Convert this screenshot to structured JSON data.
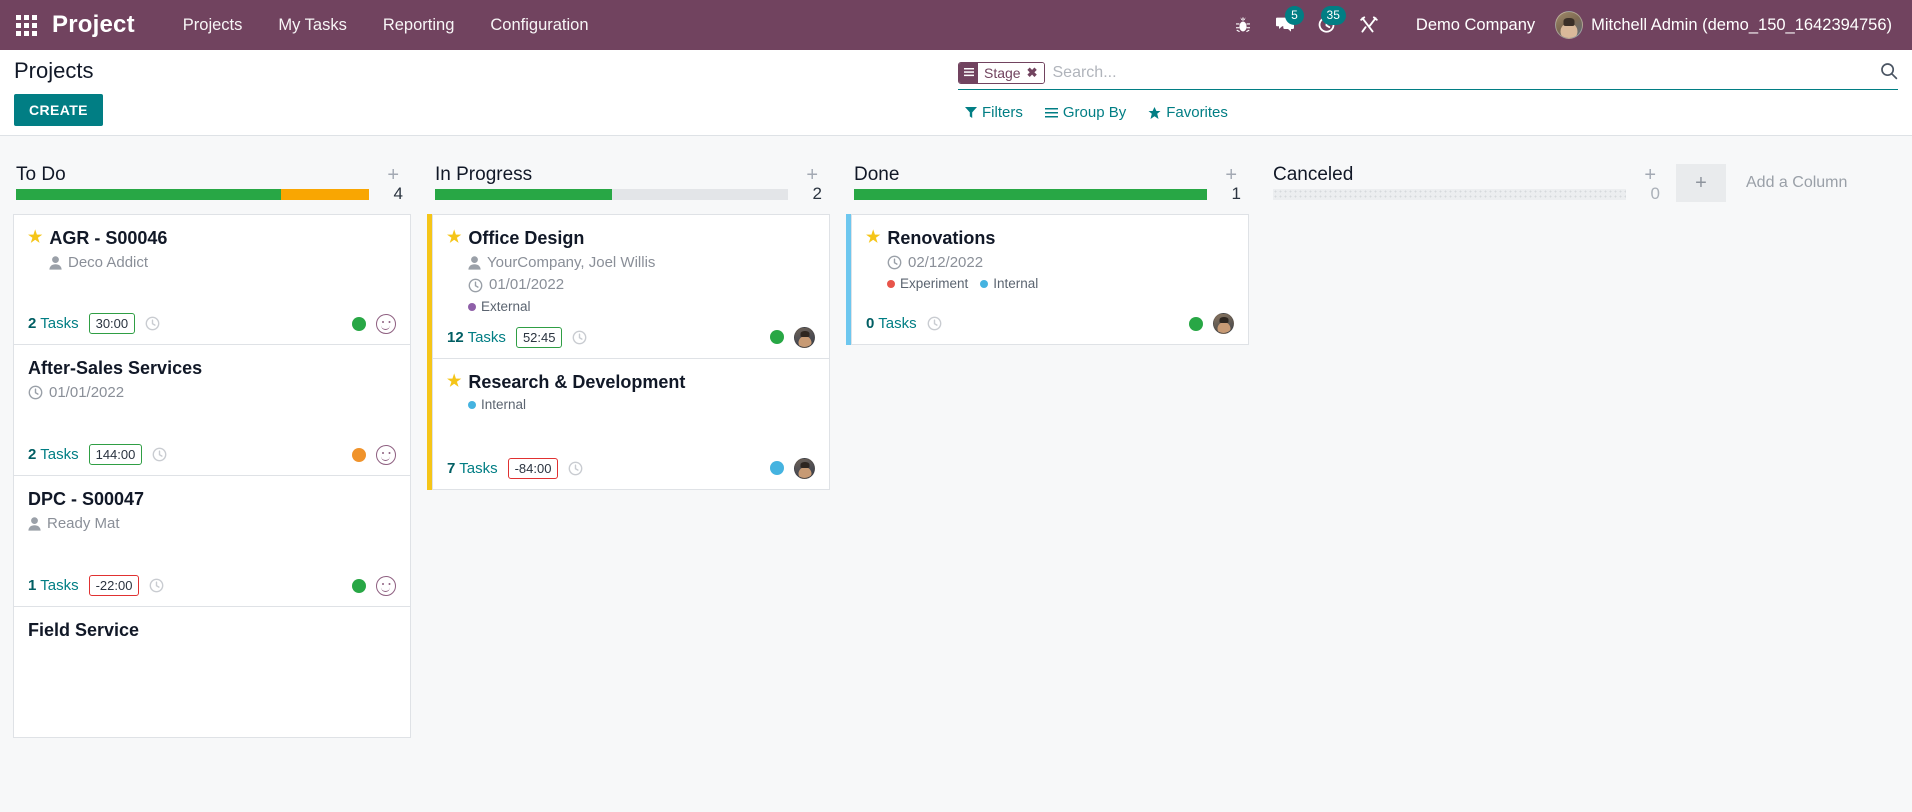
{
  "navbar": {
    "apps_icon": "apps-grid-icon",
    "brand": "Project",
    "menu": [
      {
        "label": "Projects"
      },
      {
        "label": "My Tasks"
      },
      {
        "label": "Reporting"
      },
      {
        "label": "Configuration"
      }
    ],
    "icons": [
      {
        "name": "bug-icon",
        "badge": null
      },
      {
        "name": "messages-icon",
        "badge": "5"
      },
      {
        "name": "activities-clock-icon",
        "badge": "35"
      },
      {
        "name": "tools-icon",
        "badge": null
      }
    ],
    "company": "Demo Company",
    "user": "Mitchell Admin (demo_150_1642394756)"
  },
  "control_panel": {
    "title": "Projects",
    "create_label": "CREATE",
    "facet": {
      "label": "Stage",
      "close": "✖"
    },
    "search_placeholder": "Search...",
    "filters": [
      {
        "label": "Filters",
        "icon": "filter-icon"
      },
      {
        "label": "Group By",
        "icon": "group-by-icon"
      },
      {
        "label": "Favorites",
        "icon": "star-icon"
      }
    ]
  },
  "colors": {
    "brand_purple": "#71435f",
    "accent_teal": "#017e84",
    "bar_green": "#28a745",
    "bar_orange": "#f9a602",
    "bar_grey": "#e3e5e8",
    "dot_green": "#28a745",
    "dot_orange": "#f0932b",
    "dot_blue": "#45b3e0",
    "star_yellow": "#f5c518",
    "tag_purple": "#8e5fa8",
    "tag_blue": "#45b3e0",
    "tag_red": "#e8544a",
    "group_yellow": "#f5c518",
    "group_lightblue": "#6dc7ef"
  },
  "kanban": {
    "add_column_label": "Add a Column",
    "columns": [
      {
        "title": "To Do",
        "count": "4",
        "progress": [
          {
            "color": "#28a745",
            "pct": 75
          },
          {
            "color": "#f9a602",
            "pct": 25
          }
        ],
        "group_border": "transparent",
        "cards": [
          {
            "title": "AGR - S00046",
            "starred": true,
            "partner": "Deco Addict",
            "date": null,
            "tags": [],
            "tasks": "2",
            "tasks_label": "Tasks",
            "hours": "30:00",
            "hours_negative": false,
            "status_dot": "#28a745",
            "right_widget": "smiley"
          },
          {
            "title": "After-Sales Services",
            "starred": false,
            "partner": null,
            "date": "01/01/2022",
            "tags": [],
            "tasks": "2",
            "tasks_label": "Tasks",
            "hours": "144:00",
            "hours_negative": false,
            "status_dot": "#f0932b",
            "right_widget": "smiley"
          },
          {
            "title": "DPC - S00047",
            "starred": false,
            "partner": "Ready Mat",
            "date": null,
            "tags": [],
            "tasks": "1",
            "tasks_label": "Tasks",
            "hours": "-22:00",
            "hours_negative": true,
            "status_dot": "#28a745",
            "right_widget": "smiley"
          },
          {
            "title": "Field Service",
            "starred": false,
            "partner": null,
            "date": null,
            "tags": [],
            "tasks": null,
            "tasks_label": null,
            "hours": null,
            "hours_negative": false,
            "status_dot": null,
            "right_widget": null
          }
        ]
      },
      {
        "title": "In Progress",
        "count": "2",
        "progress": [
          {
            "color": "#28a745",
            "pct": 50
          }
        ],
        "group_border": "#f5c518",
        "cards": [
          {
            "title": "Office Design",
            "starred": true,
            "partner": "YourCompany, Joel Willis",
            "date": "01/01/2022",
            "tags": [
              {
                "label": "External",
                "color": "#8e5fa8"
              }
            ],
            "tasks": "12",
            "tasks_label": "Tasks",
            "hours": "52:45",
            "hours_negative": false,
            "status_dot": "#28a745",
            "right_widget": "avatar-a"
          },
          {
            "title": "Research & Development",
            "starred": true,
            "partner": null,
            "date": null,
            "tags": [
              {
                "label": "Internal",
                "color": "#45b3e0"
              }
            ],
            "tasks": "7",
            "tasks_label": "Tasks",
            "hours": "-84:00",
            "hours_negative": true,
            "status_dot": "#45b3e0",
            "right_widget": "avatar-a"
          }
        ]
      },
      {
        "title": "Done",
        "count": "1",
        "progress": [
          {
            "color": "#28a745",
            "pct": 100
          }
        ],
        "group_border": "#6dc7ef",
        "cards": [
          {
            "title": "Renovations",
            "starred": true,
            "partner": null,
            "date": "02/12/2022",
            "tags": [
              {
                "label": "Experiment",
                "color": "#e8544a"
              },
              {
                "label": "Internal",
                "color": "#45b3e0"
              }
            ],
            "tasks": "0",
            "tasks_label": "Tasks",
            "hours": null,
            "hours_negative": false,
            "status_dot": "#28a745",
            "right_widget": "avatar-b"
          }
        ]
      },
      {
        "title": "Canceled",
        "count": "0",
        "count_muted": true,
        "progress": [],
        "progress_empty": true,
        "group_border": "transparent",
        "cards": []
      }
    ]
  }
}
